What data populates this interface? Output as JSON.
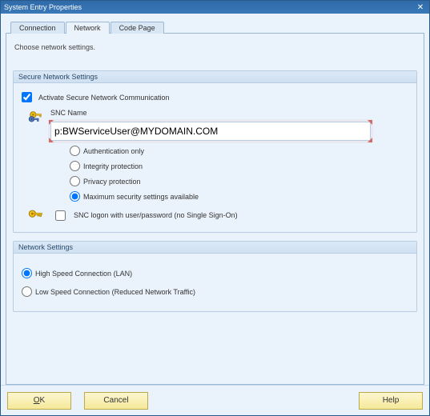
{
  "window": {
    "title": "System Entry Properties",
    "close_glyph": "✕"
  },
  "tabs": {
    "connection": "Connection",
    "network": "Network",
    "codepage": "Code Page"
  },
  "instruction": "Choose network settings.",
  "secure_group": {
    "title": "Secure Network Settings",
    "activate_label": "Activate Secure Network Communication",
    "snc_name_label": "SNC Name",
    "snc_name_value": "p:BWServiceUser@MYDOMAIN.COM",
    "auth_label": "Authentication only",
    "integrity_label": "Integrity protection",
    "privacy_label": "Privacy protection",
    "max_label": "Maximum security settings available",
    "logon_label": "SNC logon with user/password (no Single Sign-On)"
  },
  "network_group": {
    "title": "Network Settings",
    "high_label": "High Speed Connection (LAN)",
    "low_label": "Low Speed Connection (Reduced Network Traffic)"
  },
  "buttons": {
    "ok": "OK",
    "cancel": "Cancel",
    "help": "Help"
  }
}
